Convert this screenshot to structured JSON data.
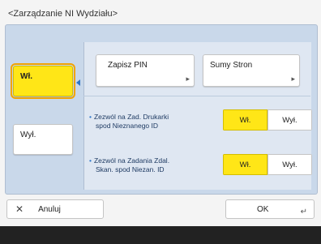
{
  "title": "<Zarządzanie NI Wydziału>",
  "left": {
    "on_label": "Wł.",
    "off_label": "Wył.",
    "selected": "on"
  },
  "top_buttons": {
    "register_pin": "Zapisz PIN",
    "page_totals": "Sumy Stron"
  },
  "options": [
    {
      "label_line1": "Zezwól na Zad. Drukarki",
      "label_line2": "spod Nieznanego ID",
      "on": "Wł.",
      "off": "Wył.",
      "value": "on"
    },
    {
      "label_line1": "Zezwól na Zadania Zdal.",
      "label_line2": "Skan. spod Niezan. ID",
      "on": "Wł.",
      "off": "Wył.",
      "value": "on"
    }
  ],
  "footer": {
    "cancel": "Anuluj",
    "ok": "OK"
  },
  "icons": {
    "cancel": "close-icon",
    "ok": "return-icon",
    "submenu": "corner-arrow-icon"
  },
  "colors": {
    "selected_yellow": "#ffe617",
    "focus_outline": "#f2a300",
    "panel": "#c9d8ea"
  }
}
